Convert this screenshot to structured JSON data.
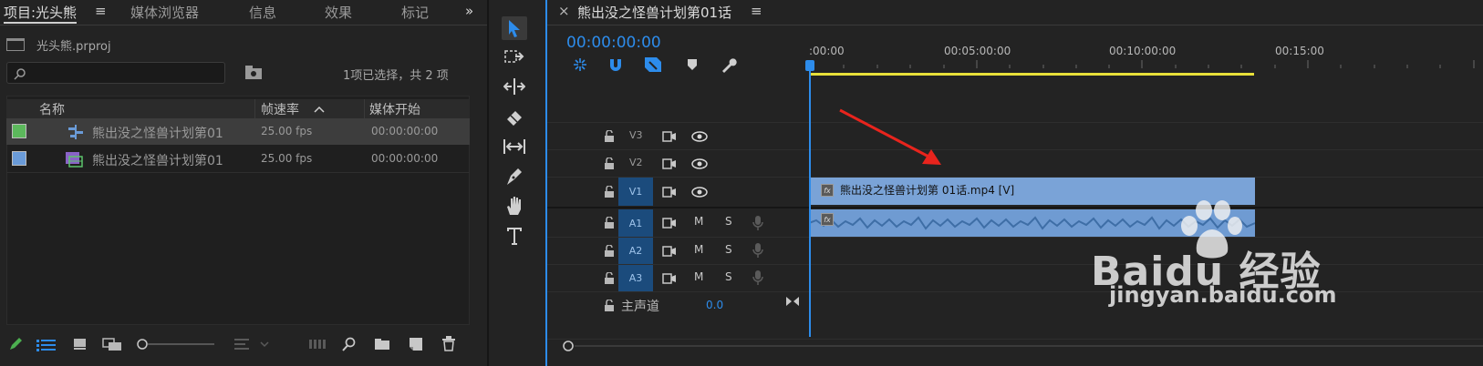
{
  "project_panel": {
    "tabs": [
      "项目:光头熊",
      "媒体浏览器",
      "信息",
      "效果",
      "标记"
    ],
    "menu_glyph": "≡",
    "more_glyph": "»",
    "project_file": "光头熊.prproj",
    "selection_status": "1项已选择，共 2 项",
    "columns": {
      "name": "名称",
      "framerate": "帧速率",
      "media_start": "媒体开始"
    },
    "items": [
      {
        "name": "熊出没之怪兽计划第01",
        "framerate": "25.00 fps",
        "media_start": "00:00:00:00",
        "color": "#5cb85c",
        "selected": true
      },
      {
        "name": "熊出没之怪兽计划第01",
        "framerate": "25.00 fps",
        "media_start": "00:00:00:00",
        "color": "#6a9bd8",
        "selected": false
      }
    ]
  },
  "timeline": {
    "close_glyph": "×",
    "sequence_title": "熊出没之怪兽计划第01话",
    "menu_glyph": "≡",
    "timecode": "00:00:00:00",
    "ruler_ticks": [
      ":00:00",
      "00:05:00:00",
      "00:10:00:00",
      "00:15:00"
    ],
    "video_tracks": [
      "V3",
      "V2",
      "V1"
    ],
    "audio_tracks": [
      "A1",
      "A2",
      "A3"
    ],
    "mute_label": "M",
    "solo_label": "S",
    "master_label": "主声道",
    "master_value": "0.0",
    "video_clip_label": "熊出没之怪兽计划第 01话.mp4 [V]",
    "fx_label": "fx"
  },
  "watermark": {
    "brand": "Baidu 经验",
    "url": "jingyan.baidu.com"
  },
  "colors": {
    "accent": "#2d8ceb",
    "clip_video": "#7aa3d7",
    "clip_audio": "#6f9bd2",
    "work_area": "#e8e03a",
    "arrow": "#e8241d"
  }
}
